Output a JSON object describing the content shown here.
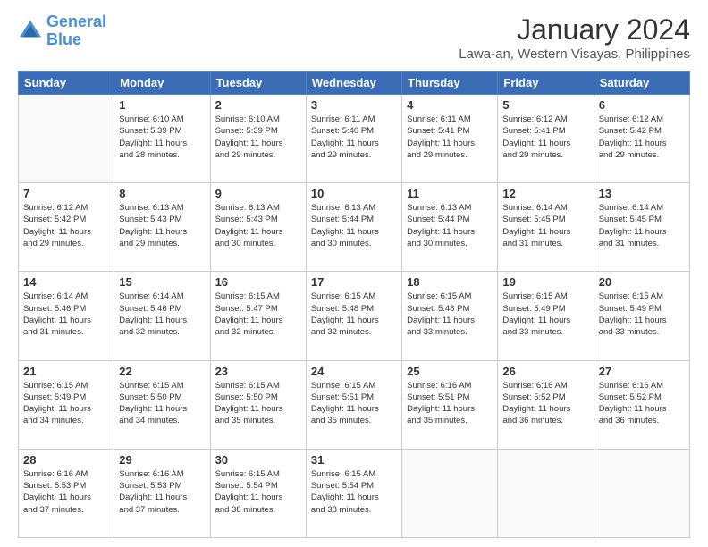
{
  "header": {
    "logo_line1": "General",
    "logo_line2": "Blue",
    "title": "January 2024",
    "subtitle": "Lawa-an, Western Visayas, Philippines"
  },
  "weekdays": [
    "Sunday",
    "Monday",
    "Tuesday",
    "Wednesday",
    "Thursday",
    "Friday",
    "Saturday"
  ],
  "weeks": [
    [
      {
        "day": "",
        "sunrise": "",
        "sunset": "",
        "daylight": ""
      },
      {
        "day": "1",
        "sunrise": "6:10 AM",
        "sunset": "5:39 PM",
        "daylight": "11 hours and 28 minutes."
      },
      {
        "day": "2",
        "sunrise": "6:10 AM",
        "sunset": "5:39 PM",
        "daylight": "11 hours and 29 minutes."
      },
      {
        "day": "3",
        "sunrise": "6:11 AM",
        "sunset": "5:40 PM",
        "daylight": "11 hours and 29 minutes."
      },
      {
        "day": "4",
        "sunrise": "6:11 AM",
        "sunset": "5:41 PM",
        "daylight": "11 hours and 29 minutes."
      },
      {
        "day": "5",
        "sunrise": "6:12 AM",
        "sunset": "5:41 PM",
        "daylight": "11 hours and 29 minutes."
      },
      {
        "day": "6",
        "sunrise": "6:12 AM",
        "sunset": "5:42 PM",
        "daylight": "11 hours and 29 minutes."
      }
    ],
    [
      {
        "day": "7",
        "sunrise": "6:12 AM",
        "sunset": "5:42 PM",
        "daylight": "11 hours and 29 minutes."
      },
      {
        "day": "8",
        "sunrise": "6:13 AM",
        "sunset": "5:43 PM",
        "daylight": "11 hours and 29 minutes."
      },
      {
        "day": "9",
        "sunrise": "6:13 AM",
        "sunset": "5:43 PM",
        "daylight": "11 hours and 30 minutes."
      },
      {
        "day": "10",
        "sunrise": "6:13 AM",
        "sunset": "5:44 PM",
        "daylight": "11 hours and 30 minutes."
      },
      {
        "day": "11",
        "sunrise": "6:13 AM",
        "sunset": "5:44 PM",
        "daylight": "11 hours and 30 minutes."
      },
      {
        "day": "12",
        "sunrise": "6:14 AM",
        "sunset": "5:45 PM",
        "daylight": "11 hours and 31 minutes."
      },
      {
        "day": "13",
        "sunrise": "6:14 AM",
        "sunset": "5:45 PM",
        "daylight": "11 hours and 31 minutes."
      }
    ],
    [
      {
        "day": "14",
        "sunrise": "6:14 AM",
        "sunset": "5:46 PM",
        "daylight": "11 hours and 31 minutes."
      },
      {
        "day": "15",
        "sunrise": "6:14 AM",
        "sunset": "5:46 PM",
        "daylight": "11 hours and 32 minutes."
      },
      {
        "day": "16",
        "sunrise": "6:15 AM",
        "sunset": "5:47 PM",
        "daylight": "11 hours and 32 minutes."
      },
      {
        "day": "17",
        "sunrise": "6:15 AM",
        "sunset": "5:48 PM",
        "daylight": "11 hours and 32 minutes."
      },
      {
        "day": "18",
        "sunrise": "6:15 AM",
        "sunset": "5:48 PM",
        "daylight": "11 hours and 33 minutes."
      },
      {
        "day": "19",
        "sunrise": "6:15 AM",
        "sunset": "5:49 PM",
        "daylight": "11 hours and 33 minutes."
      },
      {
        "day": "20",
        "sunrise": "6:15 AM",
        "sunset": "5:49 PM",
        "daylight": "11 hours and 33 minutes."
      }
    ],
    [
      {
        "day": "21",
        "sunrise": "6:15 AM",
        "sunset": "5:49 PM",
        "daylight": "11 hours and 34 minutes."
      },
      {
        "day": "22",
        "sunrise": "6:15 AM",
        "sunset": "5:50 PM",
        "daylight": "11 hours and 34 minutes."
      },
      {
        "day": "23",
        "sunrise": "6:15 AM",
        "sunset": "5:50 PM",
        "daylight": "11 hours and 35 minutes."
      },
      {
        "day": "24",
        "sunrise": "6:15 AM",
        "sunset": "5:51 PM",
        "daylight": "11 hours and 35 minutes."
      },
      {
        "day": "25",
        "sunrise": "6:16 AM",
        "sunset": "5:51 PM",
        "daylight": "11 hours and 35 minutes."
      },
      {
        "day": "26",
        "sunrise": "6:16 AM",
        "sunset": "5:52 PM",
        "daylight": "11 hours and 36 minutes."
      },
      {
        "day": "27",
        "sunrise": "6:16 AM",
        "sunset": "5:52 PM",
        "daylight": "11 hours and 36 minutes."
      }
    ],
    [
      {
        "day": "28",
        "sunrise": "6:16 AM",
        "sunset": "5:53 PM",
        "daylight": "11 hours and 37 minutes."
      },
      {
        "day": "29",
        "sunrise": "6:16 AM",
        "sunset": "5:53 PM",
        "daylight": "11 hours and 37 minutes."
      },
      {
        "day": "30",
        "sunrise": "6:15 AM",
        "sunset": "5:54 PM",
        "daylight": "11 hours and 38 minutes."
      },
      {
        "day": "31",
        "sunrise": "6:15 AM",
        "sunset": "5:54 PM",
        "daylight": "11 hours and 38 minutes."
      },
      {
        "day": "",
        "sunrise": "",
        "sunset": "",
        "daylight": ""
      },
      {
        "day": "",
        "sunrise": "",
        "sunset": "",
        "daylight": ""
      },
      {
        "day": "",
        "sunrise": "",
        "sunset": "",
        "daylight": ""
      }
    ]
  ]
}
